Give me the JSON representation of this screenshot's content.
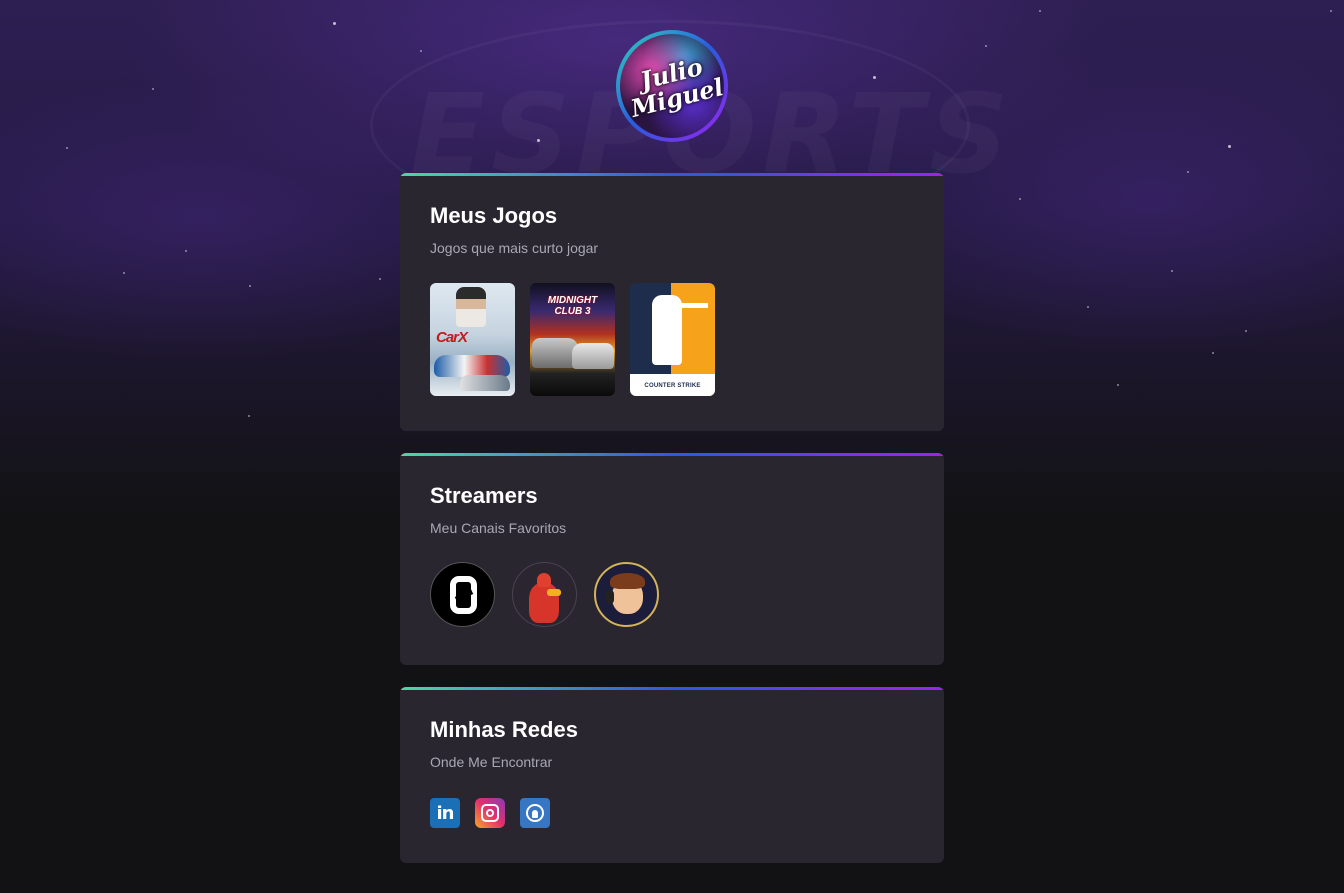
{
  "profile": {
    "avatar_line1": "Julio",
    "avatar_line2": "Miguel",
    "ring_gradient": [
      "#2fd3b8",
      "#2a5be0",
      "#a020f0"
    ]
  },
  "background": {
    "watermark": "ESPORTS"
  },
  "sections": {
    "games": {
      "title": "Meus Jogos",
      "subtitle": "Jogos que mais curto jogar",
      "items": [
        {
          "name": "CarX Drift Racing",
          "logo": "CarX"
        },
        {
          "name": "Midnight Club 3",
          "logo": "MIDNIGHT CLUB 3"
        },
        {
          "name": "Counter-Strike",
          "logo": "COUNTER STRIKE"
        }
      ]
    },
    "streamers": {
      "title": "Streamers",
      "subtitle": "Meu Canais Favoritos",
      "items": [
        {
          "name": "streamer-1"
        },
        {
          "name": "streamer-2"
        },
        {
          "name": "streamer-3"
        }
      ]
    },
    "networks": {
      "title": "Minhas Redes",
      "subtitle": "Onde Me Encontrar",
      "items": [
        {
          "name": "linkedin",
          "icon": "linkedin-icon",
          "glyph": "in",
          "color": "#1a6fb6"
        },
        {
          "name": "instagram",
          "icon": "instagram-icon",
          "color": "#e3306c"
        },
        {
          "name": "github",
          "icon": "github-icon",
          "color": "#3776c3"
        }
      ]
    }
  },
  "colors": {
    "card_bg": "#29262f",
    "card_border_gradient": [
      "#4ed8a4",
      "#2a5be0",
      "#a020f0"
    ],
    "title": "#ffffff",
    "subtitle": "#a8a8b3",
    "page_bg": "#121214"
  }
}
